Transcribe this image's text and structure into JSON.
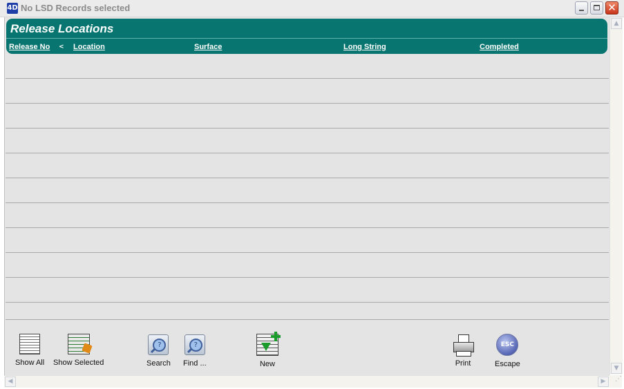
{
  "window": {
    "title": "No LSD Records selected",
    "app_icon": "4D"
  },
  "panel": {
    "title": "Release Locations"
  },
  "columns": [
    {
      "label": "Release No"
    },
    {
      "label": "Location"
    },
    {
      "label": "Surface"
    },
    {
      "label": "Long String"
    },
    {
      "label": "Completed"
    }
  ],
  "sort_indicator": "<",
  "toolbar": {
    "show_all": "Show All",
    "show_selected": "Show Selected",
    "search": "Search",
    "find": "Find ...",
    "new": "New",
    "print": "Print",
    "escape": "Escape",
    "escape_icon_text": "ESC"
  },
  "colors": {
    "header_bg": "#087570",
    "list_bg": "#e4e4e4",
    "row_line": "#a9a9a9"
  }
}
